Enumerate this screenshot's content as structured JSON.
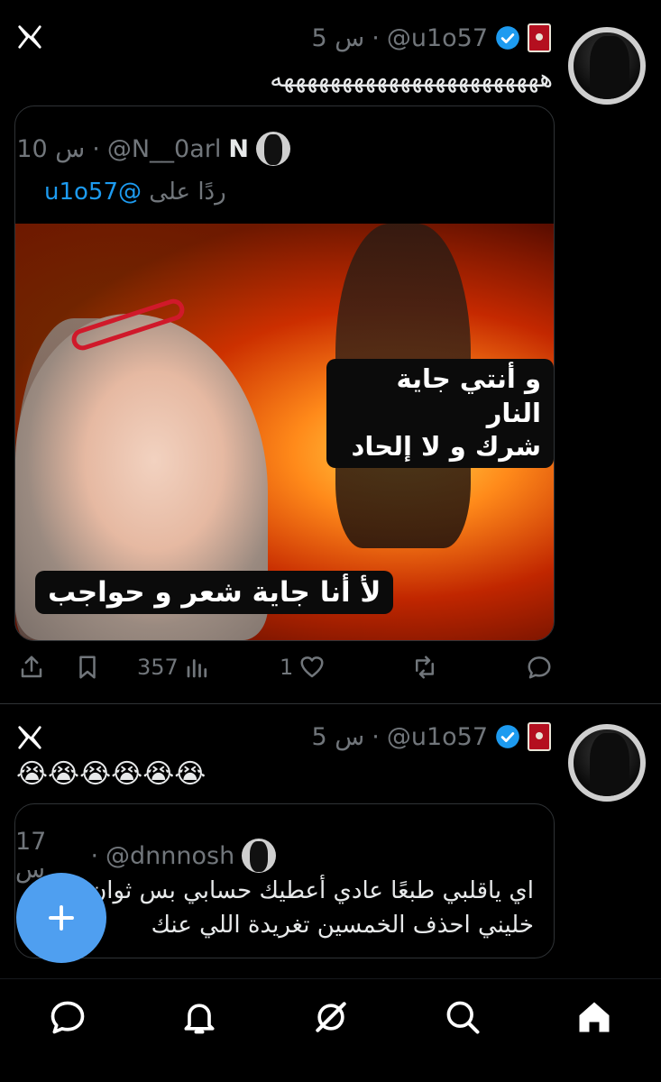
{
  "tweets": [
    {
      "handle": "@u1o57",
      "time": "5 س",
      "text": "هههههههههههههههههههههههه",
      "quote": {
        "name": "N",
        "handle": "@N__0arl",
        "time": "10 س",
        "reply_prefix": "ردًا على",
        "reply_mention": "@u1o57",
        "meme_caption_top_line1": "و أنتي جاية النار",
        "meme_caption_top_line2": "شرك و لا إلحاد",
        "meme_caption_bottom": "لأ أنا جاية شعر و حواجب"
      },
      "actions": {
        "views": "357",
        "likes": "1"
      }
    },
    {
      "handle": "@u1o57",
      "time": "5 س",
      "text": "😭😭😭😭😭😭",
      "quote": {
        "handle": "@dnnnosh",
        "time": "17 س",
        "line1": "اي ياقلبي طبعًا عادي أعطيك حسابي بس ثوان",
        "line2": "خليني احذف الخمسين تغريدة اللي عنك"
      }
    }
  ],
  "icons": {
    "x_logo": "x-logo-icon",
    "verified": "verified-badge-icon",
    "share": "share-icon",
    "bookmark": "bookmark-icon",
    "views": "views-icon",
    "like": "heart-icon",
    "retweet": "retweet-icon",
    "reply": "reply-icon",
    "compose": "plus-icon"
  },
  "nav": [
    "messages-icon",
    "notifications-icon",
    "grok-icon",
    "search-icon",
    "home-icon"
  ],
  "colors": {
    "accent": "#1d9bf0",
    "fab": "#4f9ff0",
    "muted": "#71767b"
  }
}
